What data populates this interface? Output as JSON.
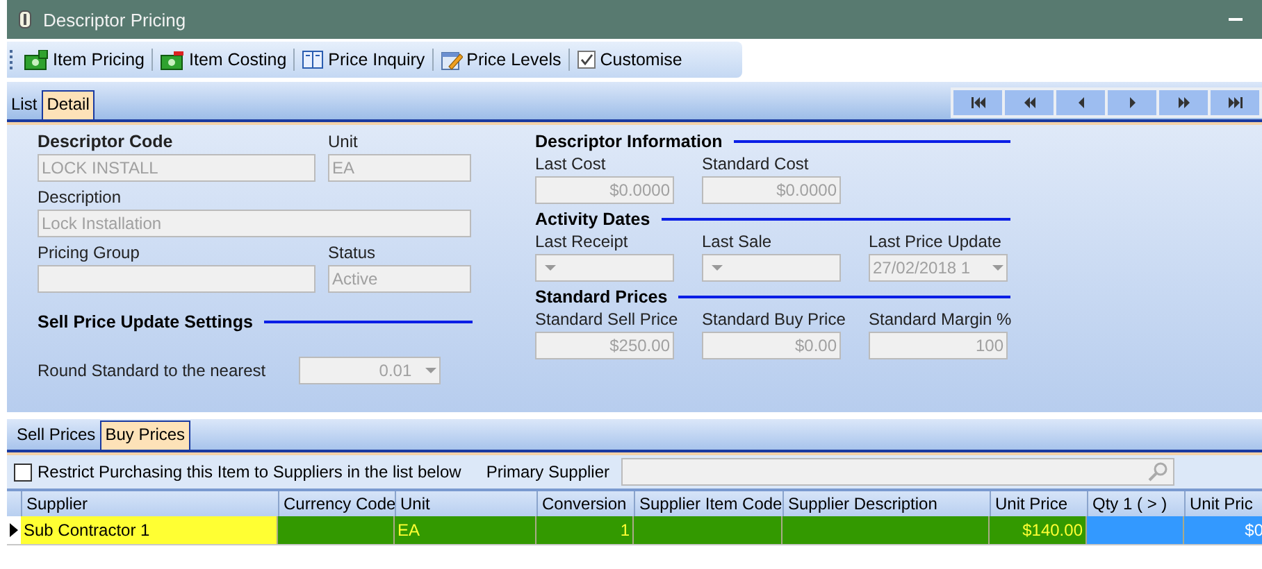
{
  "window": {
    "title": "Descriptor Pricing"
  },
  "toolbar": [
    {
      "label": "Item Pricing",
      "kind": "money-add"
    },
    {
      "label": "Item Costing",
      "kind": "money-minus"
    },
    {
      "label": "Price Inquiry",
      "kind": "book"
    },
    {
      "label": "Price Levels",
      "kind": "edit"
    },
    {
      "label": "Customise",
      "kind": "check"
    }
  ],
  "view_tabs": [
    {
      "label": "List",
      "selected": false
    },
    {
      "label": "Detail",
      "selected": true
    }
  ],
  "navigator": [
    {
      "kind": "first"
    },
    {
      "kind": "fast-back"
    },
    {
      "kind": "back"
    },
    {
      "kind": "forward"
    },
    {
      "kind": "fast-forward"
    },
    {
      "kind": "last"
    }
  ],
  "left_fields": [
    {
      "label": "Descriptor Code",
      "heading": true,
      "value": "LOCK INSTALL"
    },
    {
      "label": "Unit",
      "heading": false,
      "value": "EA"
    },
    {
      "label": "Description",
      "heading": false,
      "value": "Lock Installation"
    },
    {
      "label": "Pricing Group",
      "heading": false
    },
    {
      "label": "Status",
      "heading": false,
      "value": "Active"
    }
  ],
  "sell_price_update_settings": {
    "title": "Sell Price Update Settings",
    "round_label": "Round Standard to the nearest",
    "round_value": "0.01"
  },
  "sections": [
    {
      "title": "Descriptor Information",
      "fields": [
        {
          "label": "Last Cost",
          "kind": "amount",
          "value": "$0.0000"
        },
        {
          "label": "Standard Cost",
          "kind": "amount",
          "value": "$0.0000"
        }
      ]
    },
    {
      "title": "Activity Dates",
      "fields": [
        {
          "label": "Last Receipt",
          "kind": "dropdown"
        },
        {
          "label": "Last Sale",
          "kind": "dropdown"
        },
        {
          "label": "Last Price Update",
          "kind": "dropdown",
          "value": "27/02/2018 1"
        }
      ]
    },
    {
      "title": "Standard Prices",
      "fields": [
        {
          "label": "Standard Sell Price",
          "kind": "amount",
          "value": "$250.00"
        },
        {
          "label": "Standard Buy Price",
          "kind": "amount",
          "value": "$0.00"
        },
        {
          "label": "Standard Margin %",
          "kind": "amount",
          "value": "100"
        }
      ]
    }
  ],
  "price_tabs": [
    {
      "label": "Sell Prices",
      "selected": false
    },
    {
      "label": "Buy Prices",
      "selected": true
    }
  ],
  "restrict": {
    "label": "Restrict Purchasing this Item to Suppliers in the list below",
    "checked": false
  },
  "primary_supplier": {
    "label": "Primary Supplier"
  },
  "grid": {
    "columns": [
      {
        "label": "Supplier"
      },
      {
        "label": "Currency Code"
      },
      {
        "label": "Unit"
      },
      {
        "label": "Conversion"
      },
      {
        "label": "Supplier Item Code"
      },
      {
        "label": "Supplier Description"
      },
      {
        "label": "Unit Price"
      },
      {
        "label": "Qty 1 ( > )"
      },
      {
        "label": "Unit Pric"
      }
    ],
    "rows": [
      {
        "current": true,
        "cells": [
          {
            "text": "Sub Contractor 1",
            "color": "#ffff33"
          },
          {
            "color": "#339900"
          },
          {
            "text": "EA",
            "color": "#339900"
          },
          {
            "text": "1",
            "color": "#339900"
          },
          {
            "color": "#339900"
          },
          {
            "color": "#339900"
          },
          {
            "text": "$140.00",
            "color": "#339900"
          },
          {
            "color": "#3399ff"
          },
          {
            "text": "$0",
            "color": "#3399ff"
          }
        ]
      }
    ]
  }
}
